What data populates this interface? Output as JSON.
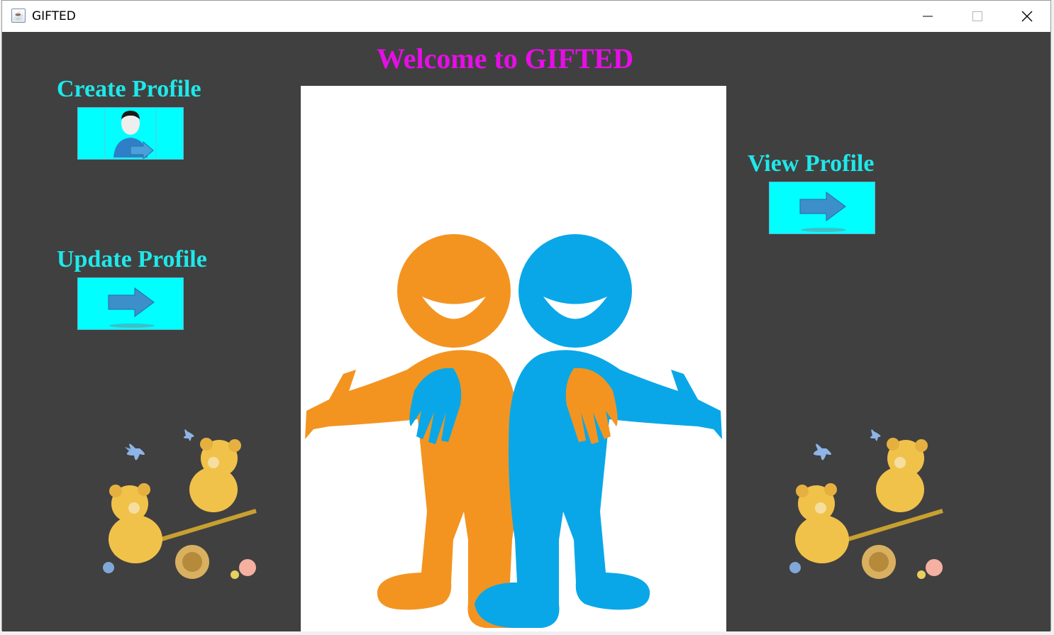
{
  "window": {
    "title": "GIFTED",
    "icons": {
      "app": "java-cup-icon",
      "minimize": "minimize-icon",
      "maximize": "maximize-icon",
      "close": "close-icon"
    }
  },
  "main": {
    "welcome": "Welcome to GIFTED",
    "create_profile": "Create Profile",
    "update_profile": "Update Profile",
    "view_profile": "View Profile"
  },
  "colors": {
    "background": "#404040",
    "welcome_text": "#e60ee6",
    "label_text": "#1ee8ea",
    "button_fill": "#00ffff",
    "figure_orange": "#f39420",
    "figure_blue": "#0aa7e8"
  }
}
